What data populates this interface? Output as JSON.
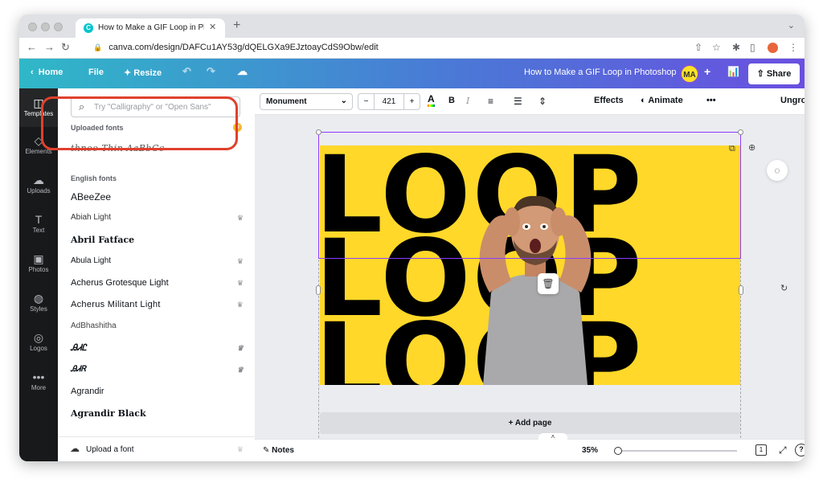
{
  "browser": {
    "tab_title": "How to Make a GIF Loop in Photoshop",
    "tab_title_display": "How to Make a GIF Loop in Pho",
    "url": "canva.com/design/DAFCu1AY53g/dQELGXa9EJztoayCdS9Obw/edit",
    "new_tab": "+",
    "close_tab": "✕"
  },
  "header": {
    "home": "Home",
    "file": "File",
    "resize": "Resize",
    "design_title": "How to Make a GIF Loop in Photoshop",
    "avatar_initials": "MA",
    "share": "Share"
  },
  "rail": {
    "items": [
      {
        "label": "Templates",
        "icon": "templates-icon"
      },
      {
        "label": "Elements",
        "icon": "elements-icon"
      },
      {
        "label": "Uploads",
        "icon": "uploads-icon"
      },
      {
        "label": "Text",
        "icon": "text-icon"
      },
      {
        "label": "Photos",
        "icon": "photos-icon"
      },
      {
        "label": "Styles",
        "icon": "styles-icon"
      },
      {
        "label": "Logos",
        "icon": "logos-icon"
      },
      {
        "label": "More",
        "icon": "more-icon"
      }
    ]
  },
  "font_panel": {
    "search_placeholder": "Try \"Calligraphy\" or \"Open Sans\"",
    "uploaded_title": "Uploaded fonts",
    "uploaded_font": "thnoo Thin AaBbCc",
    "english_title": "English fonts",
    "fonts": [
      {
        "name": "ABeeZee",
        "premium": false
      },
      {
        "name": "Abiah Light",
        "premium": true
      },
      {
        "name": "Abril Fatface",
        "premium": false
      },
      {
        "name": "Abula Light",
        "premium": true
      },
      {
        "name": "Acherus Grotesque Light",
        "premium": true
      },
      {
        "name": "Acherus Militant Light",
        "premium": true
      },
      {
        "name": "AdBhashitha",
        "premium": false
      },
      {
        "name": "ᎯᏗᏝ",
        "premium": true
      },
      {
        "name": "ᎯᏗᏒ",
        "premium": true
      },
      {
        "name": "Agrandir",
        "premium": false
      },
      {
        "name": "Agrandir Black",
        "premium": false
      }
    ],
    "upload_label": "Upload a font"
  },
  "toolbar": {
    "font_name": "Monument",
    "font_size": "421",
    "minus": "−",
    "plus": "+",
    "effects": "Effects",
    "animate": "Animate",
    "more": "•••",
    "ungroup": "Ungroup"
  },
  "canvas": {
    "loop_text": "LOOP",
    "add_page": "+ Add page",
    "background_color": "#ffd829"
  },
  "bottom": {
    "notes": "Notes",
    "zoom": "35%",
    "page_count": "1",
    "help": "?"
  },
  "colors": {
    "accent": "#8b3dff",
    "highlight": "#e0412d",
    "rail": "#18191b"
  }
}
